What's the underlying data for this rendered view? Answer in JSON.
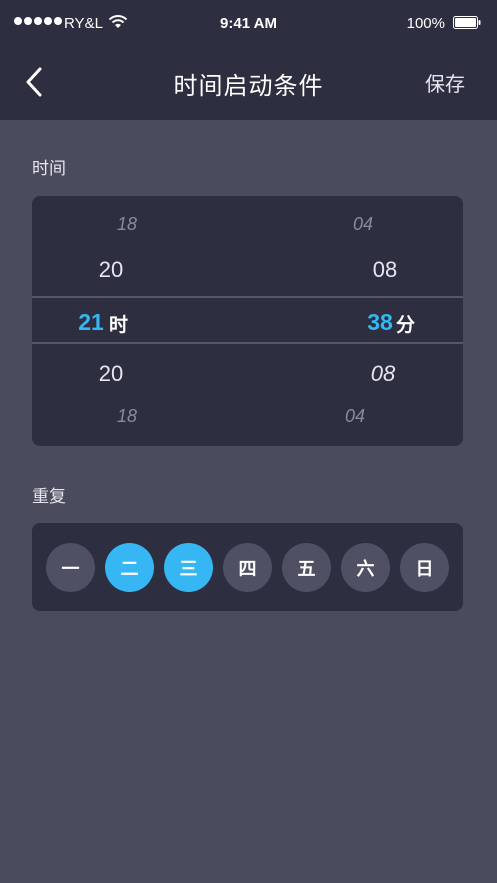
{
  "status": {
    "carrier": "RY&L",
    "time": "9:41 AM",
    "battery": "100%"
  },
  "nav": {
    "title": "时间启动条件",
    "save_label": "保存"
  },
  "time_section": {
    "label": "时间",
    "hour": {
      "far_above": "18",
      "above": "20",
      "selected": "21",
      "unit": "时",
      "below": "20",
      "far_below": "18"
    },
    "minute": {
      "far_above": "04",
      "above": "08",
      "selected": "38",
      "unit": "分",
      "below": "08",
      "far_below": "04"
    }
  },
  "repeat_section": {
    "label": "重复",
    "days": [
      {
        "label": "一",
        "selected": false
      },
      {
        "label": "二",
        "selected": true
      },
      {
        "label": "三",
        "selected": true
      },
      {
        "label": "四",
        "selected": false
      },
      {
        "label": "五",
        "selected": false
      },
      {
        "label": "六",
        "selected": false
      },
      {
        "label": "日",
        "selected": false
      }
    ]
  },
  "colors": {
    "accent": "#36b6f3",
    "background": "#4a4b5d",
    "panel": "#2d2e40"
  }
}
